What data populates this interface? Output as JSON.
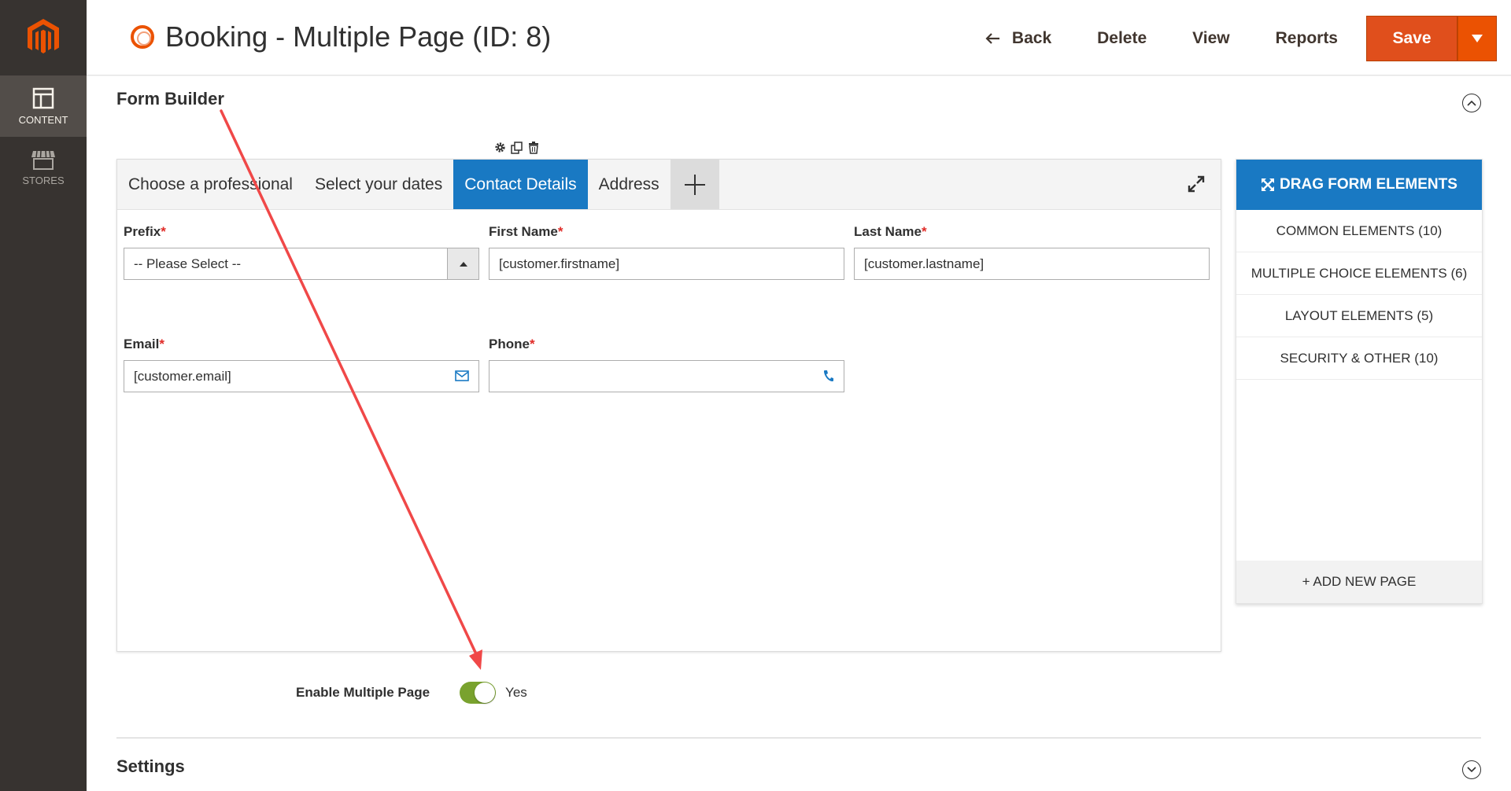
{
  "sidebar": {
    "logo": "magento-logo-icon",
    "items": [
      {
        "label": "CONTENT",
        "icon": "content-icon",
        "active": true
      },
      {
        "label": "STORES",
        "icon": "store-icon",
        "active": false
      }
    ]
  },
  "header": {
    "title": "Booking - Multiple Page (ID: 8)",
    "back_label": "Back",
    "delete_label": "Delete",
    "view_label": "View",
    "reports_label": "Reports",
    "save_label": "Save"
  },
  "form_builder": {
    "title": "Form Builder",
    "tabs": [
      {
        "label": "Choose a professional",
        "active": false
      },
      {
        "label": "Select your dates",
        "active": false
      },
      {
        "label": "Contact Details",
        "active": true
      },
      {
        "label": "Address",
        "active": false
      }
    ],
    "fields": {
      "prefix": {
        "label": "Prefix",
        "required": "*",
        "value": "-- Please Select --"
      },
      "first_name": {
        "label": "First Name",
        "required": "*",
        "value": "[customer.firstname]"
      },
      "last_name": {
        "label": "Last Name",
        "required": "*",
        "value": "[customer.lastname]"
      },
      "email": {
        "label": "Email",
        "required": "*",
        "value": "[customer.email]"
      },
      "phone": {
        "label": "Phone",
        "required": "*",
        "value": ""
      }
    }
  },
  "elements_panel": {
    "title": "DRAG FORM ELEMENTS",
    "groups": [
      "COMMON ELEMENTS (10)",
      "MULTIPLE CHOICE ELEMENTS (6)",
      "LAYOUT ELEMENTS (5)",
      "SECURITY & OTHER (10)"
    ],
    "add_page": "+ ADD NEW PAGE"
  },
  "multiple_page": {
    "label": "Enable Multiple Page",
    "value": "Yes",
    "enabled": true
  },
  "settings": {
    "title": "Settings"
  },
  "colors": {
    "accent_blue": "#1979c3",
    "brand_orange": "#eb5202",
    "annotation_red": "#f04848",
    "toggle_green": "#79a22e"
  }
}
